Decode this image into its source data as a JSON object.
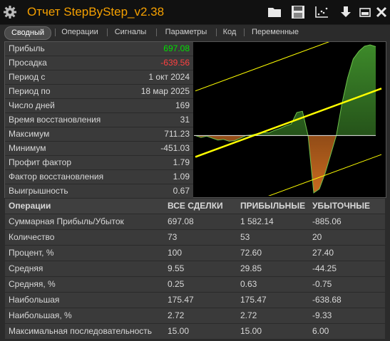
{
  "window": {
    "title": "Отчет StepByStep_v2.38",
    "accent": "#f5a000"
  },
  "toolbar": {
    "icons": [
      "gear-icon",
      "folder-icon",
      "save-icon",
      "chart-export-icon",
      "download-icon",
      "minimize-icon",
      "close-icon"
    ]
  },
  "tabs": [
    {
      "label": "Сводный",
      "active": true
    },
    {
      "label": "Операции",
      "active": false
    },
    {
      "label": "Сигналы",
      "active": false
    },
    {
      "label": "Параметры",
      "active": false
    },
    {
      "label": "Код",
      "active": false
    },
    {
      "label": "Переменные",
      "active": false
    }
  ],
  "stats": [
    {
      "label": "Прибыль",
      "value": "697.08",
      "color": "#00e000"
    },
    {
      "label": "Просадка",
      "value": "-639.56",
      "color": "#ff4040"
    },
    {
      "label": "Период с",
      "value": "1 окт 2024",
      "color": "#d8d8d8"
    },
    {
      "label": "Период по",
      "value": "18 мар 2025",
      "color": "#d8d8d8"
    },
    {
      "label": "Число дней",
      "value": "169",
      "color": "#d8d8d8"
    },
    {
      "label": "Время восстановления",
      "value": "31",
      "color": "#d8d8d8"
    },
    {
      "label": "Максимум",
      "value": "711.23",
      "color": "#d8d8d8"
    },
    {
      "label": "Минимум",
      "value": "-451.03",
      "color": "#d8d8d8"
    },
    {
      "label": "Профит фактор",
      "value": "1.79",
      "color": "#d8d8d8"
    },
    {
      "label": "Фактор восстановления",
      "value": "1.09",
      "color": "#d8d8d8"
    },
    {
      "label": "Выигрышность",
      "value": "0.67",
      "color": "#d8d8d8"
    }
  ],
  "table": {
    "headers": [
      "Операции",
      "ВСЕ СДЕЛКИ",
      "ПРИБЫЛЬНЫЕ",
      "УБЫТОЧНЫЕ"
    ],
    "rows": [
      [
        "Суммарная Прибыль/Убыток",
        "697.08",
        "1 582.14",
        "-885.06"
      ],
      [
        "Количество",
        "73",
        "53",
        "20"
      ],
      [
        "Процент, %",
        "100",
        "72.60",
        "27.40"
      ],
      [
        "Средняя",
        "9.55",
        "29.85",
        "-44.25"
      ],
      [
        "Средняя, %",
        "0.25",
        "0.63",
        "-0.75"
      ],
      [
        "Наибольшая",
        "175.47",
        "175.47",
        "-638.68"
      ],
      [
        "Наибольшая, %",
        "2.72",
        "2.72",
        "-9.33"
      ],
      [
        "Максимальная последовательность",
        "15.00",
        "15.00",
        "6.00"
      ]
    ]
  },
  "chart_data": {
    "type": "area",
    "profit_color": "#3d8a2a",
    "loss_color": "#c86a20",
    "trend_color": "#ffff00",
    "series": [
      {
        "values": [
          0,
          -15,
          -5,
          -20,
          -35,
          -30,
          -45,
          -40,
          -20,
          0,
          5,
          15,
          25,
          20,
          40,
          55,
          75,
          90,
          180,
          190,
          0,
          -450,
          -420,
          -300,
          -150,
          0,
          250,
          450,
          600,
          660,
          700,
          711,
          697
        ]
      }
    ]
  }
}
